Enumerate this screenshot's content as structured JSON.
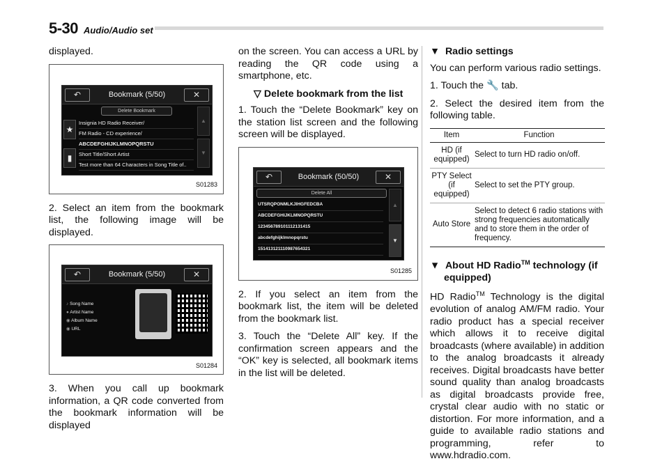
{
  "header": {
    "page_number": "5-30",
    "section": "Audio/Audio set"
  },
  "col1": {
    "p1": "displayed.",
    "fig1": {
      "title": "Bookmark (5/50)",
      "delete_btn": "Delete Bookmark",
      "rows": [
        "Insignia HD Radio Receiver/",
        "FM Radio - CD experience/",
        "ABCDEFGHIJKLMNOPQRSTU",
        "Short Title/Short Artist",
        "Test more than 64 Characters in Song Title of.."
      ],
      "caption": "S01283"
    },
    "p2": "2. Select an item from the bookmark list, the following image will be displayed.",
    "fig2": {
      "title": "Bookmark (5/50)",
      "fields": [
        "Song Name",
        "Artist Name",
        "Album Name",
        "URL"
      ],
      "caption": "S01284"
    },
    "p3": "3. When you call up bookmark information, a QR code converted from the bookmark information will be displayed"
  },
  "col2": {
    "p1": "on the screen. You can access a URL by reading the QR code using a smartphone, etc.",
    "subhead": "Delete bookmark from the list",
    "p2": "1. Touch the “Delete Bookmark” key on the station list screen and the following screen will be displayed.",
    "fig3": {
      "title": "Bookmark (50/50)",
      "delete_btn": "Delete All",
      "rows": [
        "UTSRQPONMLKJIHGFEDCBA",
        "ABCDEFGHIJKLMNOPQRSTU",
        "123456789101112131415",
        "abcdefghijklmnopqrstu",
        "151413121110987654321"
      ],
      "caption": "S01285"
    },
    "p3": "2. If you select an item from the bookmark list, the item will be deleted from the bookmark list.",
    "p4": "3. Touch the “Delete All” key. If the confirmation screen appears and the “OK” key is selected, all bookmark items in the list will be deleted."
  },
  "col3": {
    "heading1": "Radio settings",
    "p1": "You can perform various radio settings.",
    "step1_a": "1. Touch the",
    "step1_b": "tab.",
    "step2": "2. Select the desired item from the following table.",
    "table": {
      "headers": [
        "Item",
        "Function"
      ],
      "rows": [
        [
          "HD (if equipped)",
          "Select to turn HD radio on/off."
        ],
        [
          "PTY Select (if equipped)",
          "Select to set the PTY group."
        ],
        [
          "Auto Store",
          "Select to detect 6 radio stations with strong frequencies automatically and to store them in the order of frequency."
        ]
      ]
    },
    "heading2_a": "About HD Radio",
    "heading2_tm": "TM",
    "heading2_b": "technology (if equipped)",
    "p2_a": "HD Radio",
    "p2_tm": "TM",
    "p2_b": "Technology is the digital evolution of analog AM/FM radio. Your radio product has a special receiver which allows it to receive digital broadcasts (where available) in addition to the analog broadcasts it already receives. Digital broadcasts have better sound quality than analog broadcasts as digital broadcasts provide free, crystal clear audio with no static or distortion. For more information, and a guide to available radio stations and programming, refer to www.hdradio.com."
  },
  "icons": {
    "back": "back-arrow-icon",
    "close": "close-icon",
    "settings_tab": "wrench-icon"
  }
}
